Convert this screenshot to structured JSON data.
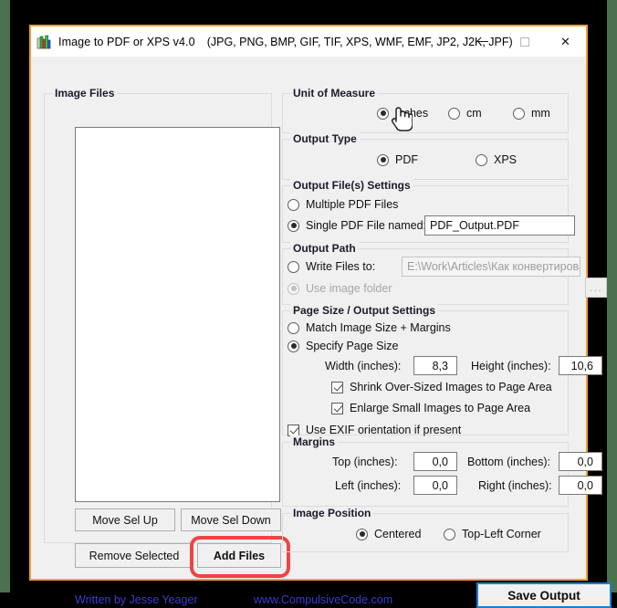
{
  "window": {
    "icon": "app-books-icon",
    "title": "Image to PDF or XPS  v4.0",
    "formats": "(JPG, PNG, BMP, GIF, TIF, XPS, WMF, EMF, JP2, J2K, JPF)",
    "controls": {
      "minimize": "minimize-icon",
      "maximize": "maximize-icon",
      "close": "✕"
    },
    "accent_border": "#f0a030",
    "backdrop": "#000000",
    "desktop_strip": "#4c7050"
  },
  "image_files": {
    "group_label": "Image Files",
    "list_items": [],
    "buttons": {
      "move_up": "Move Sel Up",
      "move_down": "Move Sel Down",
      "remove_selected": "Remove Selected",
      "add_files": "Add Files"
    },
    "annotation_color": "#ef4444"
  },
  "unit_of_measure": {
    "group_label": "Unit of Measure",
    "options": [
      {
        "label": "inches",
        "selected": true
      },
      {
        "label": "cm",
        "selected": false
      },
      {
        "label": "mm",
        "selected": false
      }
    ]
  },
  "output_type": {
    "group_label": "Output Type",
    "options": [
      {
        "label": "PDF",
        "selected": true
      },
      {
        "label": "XPS",
        "selected": false
      }
    ]
  },
  "output_files_settings": {
    "group_label": "Output File(s) Settings",
    "multiple_label": "Multiple PDF Files",
    "multiple_selected": false,
    "single_label": "Single PDF File named:",
    "single_selected": true,
    "single_filename": "PDF_Output.PDF"
  },
  "output_path": {
    "group_label": "Output Path",
    "write_files_label": "Write Files to:",
    "write_files_selected": false,
    "path_value": "E:\\Work\\Articles\\Как конвертирова",
    "browse_label": "...",
    "browse_disabled": true,
    "use_image_folder_label": "Use image folder",
    "use_image_folder_selected": true,
    "use_image_folder_disabled": true
  },
  "page_size": {
    "group_label": "Page Size / Output Settings",
    "match_image_label": "Match Image Size + Margins",
    "match_image_selected": false,
    "specify_label": "Specify Page Size",
    "specify_selected": true,
    "width_label": "Width (inches):",
    "width_value": "8,3",
    "height_label": "Height (inches):",
    "height_value": "10,6",
    "shrink_label": "Shrink Over-Sized Images to Page Area",
    "shrink_checked": true,
    "enlarge_label": "Enlarge Small Images to Page Area",
    "enlarge_checked": true,
    "exif_label": "Use EXIF orientation if present",
    "exif_checked": true
  },
  "margins": {
    "group_label": "Margins",
    "top_label": "Top (inches):",
    "top_value": "0,0",
    "bottom_label": "Bottom (inches):",
    "bottom_value": "0,0",
    "left_label": "Left (inches):",
    "left_value": "0,0",
    "right_label": "Right (inches):",
    "right_value": "0,0"
  },
  "image_position": {
    "group_label": "Image Position",
    "options": [
      {
        "label": "Centered",
        "selected": true
      },
      {
        "label": "Top-Left Corner",
        "selected": false
      }
    ]
  },
  "footer": {
    "author": "Written by Jesse Yeager",
    "website": "www.CompulsiveCode.com",
    "save_button": "Save Output",
    "link_color": "#3b3bd0",
    "save_focus_color": "#1a7fd4"
  },
  "cursor": {
    "type": "hand-pointer-cursor"
  }
}
